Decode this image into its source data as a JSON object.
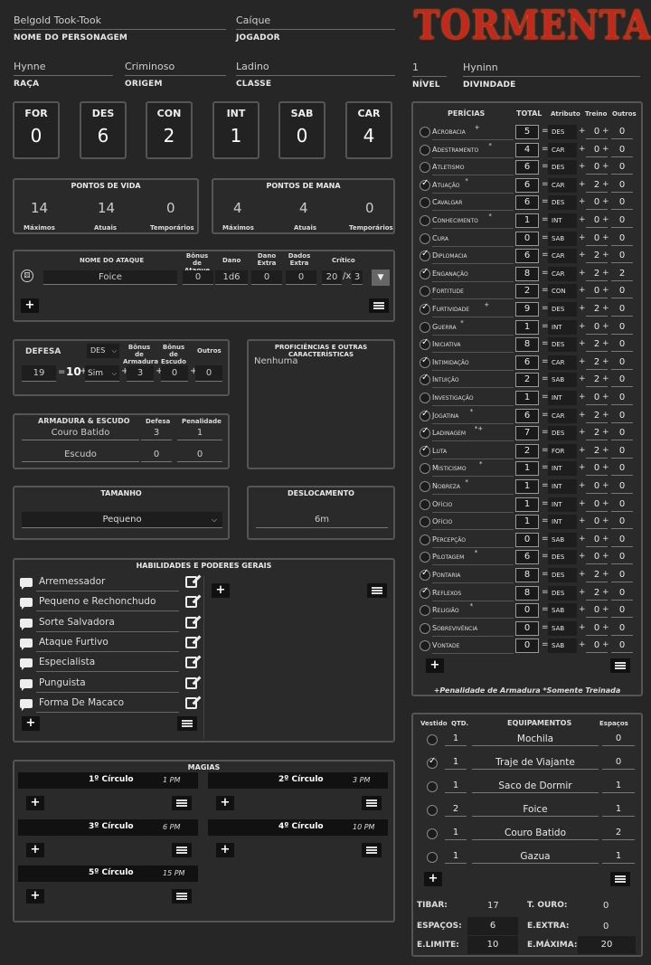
{
  "header": {
    "character_name": "Belgold Took-Took",
    "character_name_label": "NOME DO PERSONAGEM",
    "player": "Caíque",
    "player_label": "JOGADOR",
    "race": "Hynne",
    "race_label": "RAÇA",
    "origin": "Criminoso",
    "origin_label": "ORIGEM",
    "class": "Ladino",
    "class_label": "CLASSE",
    "level": "1",
    "level_label": "NÍVEL",
    "deity": "Hyninn",
    "deity_label": "DIVINDADE",
    "logo": "TORMENTA"
  },
  "attributes": [
    {
      "name": "FOR",
      "value": "0"
    },
    {
      "name": "DES",
      "value": "6"
    },
    {
      "name": "CON",
      "value": "2"
    },
    {
      "name": "INT",
      "value": "1"
    },
    {
      "name": "SAB",
      "value": "0"
    },
    {
      "name": "CAR",
      "value": "4"
    }
  ],
  "hp": {
    "title": "PONTOS DE VIDA",
    "max": "14",
    "current": "14",
    "temp": "0",
    "max_label": "Máximos",
    "current_label": "Atuais",
    "temp_label": "Temporários"
  },
  "mp": {
    "title": "PONTOS DE MANA",
    "max": "4",
    "current": "4",
    "temp": "0",
    "max_label": "Máximos",
    "current_label": "Atuais",
    "temp_label": "Temporários"
  },
  "attack": {
    "name_label": "NOME DO ATAQUE",
    "bonus_label": "Bônus de Ataque",
    "damage_label": "Dano",
    "extra_damage_label": "Dano Extra",
    "extra_dice_label": "Dados Extra",
    "crit_label": "Crítico",
    "name": "Foice",
    "bonus": "0",
    "damage": "1d6",
    "extra_damage": "0",
    "extra_dice": "0",
    "crit_range": "20",
    "crit_sep": "/x",
    "crit_mult": "3"
  },
  "defense": {
    "label": "DEFESA",
    "attr": "DES",
    "armor_bonus_label": "Bônus de Armadura",
    "shield_bonus_label": "Bônus de Escudo",
    "others_label": "Outros",
    "total": "19",
    "eq": "=",
    "base": "10",
    "plus": "+",
    "use_attr": "Sim",
    "armor_bonus": "3",
    "shield_bonus": "0",
    "others": "0"
  },
  "proficiencies": {
    "title": "PROFICIÊNCIAS E OUTRAS CARACTERÍSTICAS",
    "text": "Nenhuma"
  },
  "armor": {
    "title": "ARMADURA & ESCUDO",
    "def_label": "Defesa",
    "pen_label": "Penalidade",
    "items": [
      {
        "name": "Couro Batido",
        "def": "3",
        "pen": "1"
      },
      {
        "name": "Escudo",
        "def": "0",
        "pen": "0"
      }
    ]
  },
  "size": {
    "title": "TAMANHO",
    "value": "Pequeno"
  },
  "movement": {
    "title": "DESLOCAMENTO",
    "value": "6m"
  },
  "abilities": {
    "title": "HABILIDADES E PODERES GERAIS",
    "items": [
      "Arremessador",
      "Pequeno e Rechonchudo",
      "Sorte Salvadora",
      "Ataque Furtivo",
      "Especialista",
      "Punguista",
      "Forma De Macaco"
    ]
  },
  "magic": {
    "title": "MAGIAS",
    "circles": [
      {
        "name": "1º Círculo",
        "cost": "1 PM"
      },
      {
        "name": "2º Círculo",
        "cost": "3 PM"
      },
      {
        "name": "3º Círculo",
        "cost": "6 PM"
      },
      {
        "name": "4º Círculo",
        "cost": "10 PM"
      },
      {
        "name": "5º Círculo",
        "cost": "15 PM"
      }
    ]
  },
  "skills": {
    "title": "PERÍCIAS",
    "total_label": "TOTAL",
    "attr_label": "Atributo",
    "train_label": "Treino",
    "others_label": "Outros",
    "footer": "+Penalidade de Armadura  *Somente Treinada",
    "items": [
      {
        "name": "Acrobacia",
        "sup": "+",
        "trained": false,
        "total": "5",
        "attr": "DES",
        "train": "0",
        "others": "0"
      },
      {
        "name": "Adestramento",
        "sup": "*",
        "trained": false,
        "total": "4",
        "attr": "CAR",
        "train": "0",
        "others": "0"
      },
      {
        "name": "Atletismo",
        "sup": "",
        "trained": false,
        "total": "6",
        "attr": "DES",
        "train": "0",
        "others": "0"
      },
      {
        "name": "Atuação",
        "sup": "*",
        "trained": true,
        "total": "6",
        "attr": "CAR",
        "train": "2",
        "others": "0"
      },
      {
        "name": "Cavalgar",
        "sup": "",
        "trained": false,
        "total": "6",
        "attr": "DES",
        "train": "0",
        "others": "0"
      },
      {
        "name": "Conhecimento",
        "sup": "*",
        "trained": false,
        "total": "1",
        "attr": "INT",
        "train": "0",
        "others": "0"
      },
      {
        "name": "Cura",
        "sup": "",
        "trained": false,
        "total": "0",
        "attr": "SAB",
        "train": "0",
        "others": "0"
      },
      {
        "name": "Diplomacia",
        "sup": "",
        "trained": true,
        "total": "6",
        "attr": "CAR",
        "train": "2",
        "others": "0"
      },
      {
        "name": "Enganação",
        "sup": "",
        "trained": true,
        "total": "8",
        "attr": "CAR",
        "train": "2",
        "others": "2"
      },
      {
        "name": "Fortitude",
        "sup": "",
        "trained": false,
        "total": "2",
        "attr": "CON",
        "train": "0",
        "others": "0"
      },
      {
        "name": "Furtividade",
        "sup": "+",
        "trained": true,
        "total": "9",
        "attr": "DES",
        "train": "2",
        "others": "0"
      },
      {
        "name": "Guerra",
        "sup": "*",
        "trained": false,
        "total": "1",
        "attr": "INT",
        "train": "0",
        "others": "0"
      },
      {
        "name": "Iniciativa",
        "sup": "",
        "trained": true,
        "total": "8",
        "attr": "DES",
        "train": "2",
        "others": "0"
      },
      {
        "name": "Intimidação",
        "sup": "",
        "trained": true,
        "total": "6",
        "attr": "CAR",
        "train": "2",
        "others": "0"
      },
      {
        "name": "Intuição",
        "sup": "",
        "trained": true,
        "total": "2",
        "attr": "SAB",
        "train": "2",
        "others": "0"
      },
      {
        "name": "Investigação",
        "sup": "",
        "trained": false,
        "total": "1",
        "attr": "INT",
        "train": "0",
        "others": "0"
      },
      {
        "name": "Jogatina",
        "sup": "*",
        "trained": true,
        "total": "6",
        "attr": "CAR",
        "train": "2",
        "others": "0"
      },
      {
        "name": "Ladinagem",
        "sup": "*+",
        "trained": true,
        "total": "7",
        "attr": "DES",
        "train": "2",
        "others": "0"
      },
      {
        "name": "Luta",
        "sup": "",
        "trained": true,
        "total": "2",
        "attr": "FOR",
        "train": "2",
        "others": "0"
      },
      {
        "name": "Misticismo",
        "sup": "*",
        "trained": false,
        "total": "1",
        "attr": "INT",
        "train": "0",
        "others": "0"
      },
      {
        "name": "Nobreza",
        "sup": "*",
        "trained": false,
        "total": "1",
        "attr": "INT",
        "train": "0",
        "others": "0"
      },
      {
        "name": "Ofício",
        "sup": "",
        "trained": false,
        "total": "1",
        "attr": "INT",
        "train": "0",
        "others": "0"
      },
      {
        "name": "Ofício",
        "sup": "",
        "trained": false,
        "total": "1",
        "attr": "INT",
        "train": "0",
        "others": "0"
      },
      {
        "name": "Percepção",
        "sup": "",
        "trained": false,
        "total": "0",
        "attr": "SAB",
        "train": "0",
        "others": "0"
      },
      {
        "name": "Pilotagem",
        "sup": "*",
        "trained": false,
        "total": "6",
        "attr": "DES",
        "train": "0",
        "others": "0"
      },
      {
        "name": "Pontaria",
        "sup": "",
        "trained": true,
        "total": "8",
        "attr": "DES",
        "train": "2",
        "others": "0"
      },
      {
        "name": "Reflexos",
        "sup": "",
        "trained": true,
        "total": "8",
        "attr": "DES",
        "train": "2",
        "others": "0"
      },
      {
        "name": "Religião",
        "sup": "*",
        "trained": false,
        "total": "0",
        "attr": "SAB",
        "train": "0",
        "others": "0"
      },
      {
        "name": "Sobrevivência",
        "sup": "",
        "trained": false,
        "total": "0",
        "attr": "SAB",
        "train": "0",
        "others": "0"
      },
      {
        "name": "Vontade",
        "sup": "",
        "trained": false,
        "total": "0",
        "attr": "SAB",
        "train": "0",
        "others": "0"
      }
    ]
  },
  "equipment": {
    "equipped_label": "Vestido",
    "qty_label": "QTD.",
    "title": "EQUIPAMENTOS",
    "slots_label": "Espaços",
    "items": [
      {
        "equipped": false,
        "qty": "1",
        "name": "Mochila",
        "slots": "0"
      },
      {
        "equipped": true,
        "qty": "1",
        "name": "Traje de Viajante",
        "slots": "0"
      },
      {
        "equipped": false,
        "qty": "1",
        "name": "Saco de Dormir",
        "slots": "1"
      },
      {
        "equipped": false,
        "qty": "2",
        "name": "Foice",
        "slots": "1"
      },
      {
        "equipped": false,
        "qty": "1",
        "name": "Couro Batido",
        "slots": "2"
      },
      {
        "equipped": false,
        "qty": "1",
        "name": "Gazua",
        "slots": "1"
      }
    ],
    "tibar_label": "TIBAR:",
    "tibar": "17",
    "gold_label": "T. OURO:",
    "gold": "0",
    "slots_used_label": "ESPAÇOS:",
    "slots_used": "6",
    "extra_label": "E.EXTRA:",
    "extra": "0",
    "limit_label": "E.LIMITE:",
    "limit": "10",
    "max_label": "E.MÁXIMA:",
    "max": "20"
  },
  "colors": {
    "logo": "#c2281c",
    "panel_border": "#555555",
    "background": "#262626"
  }
}
